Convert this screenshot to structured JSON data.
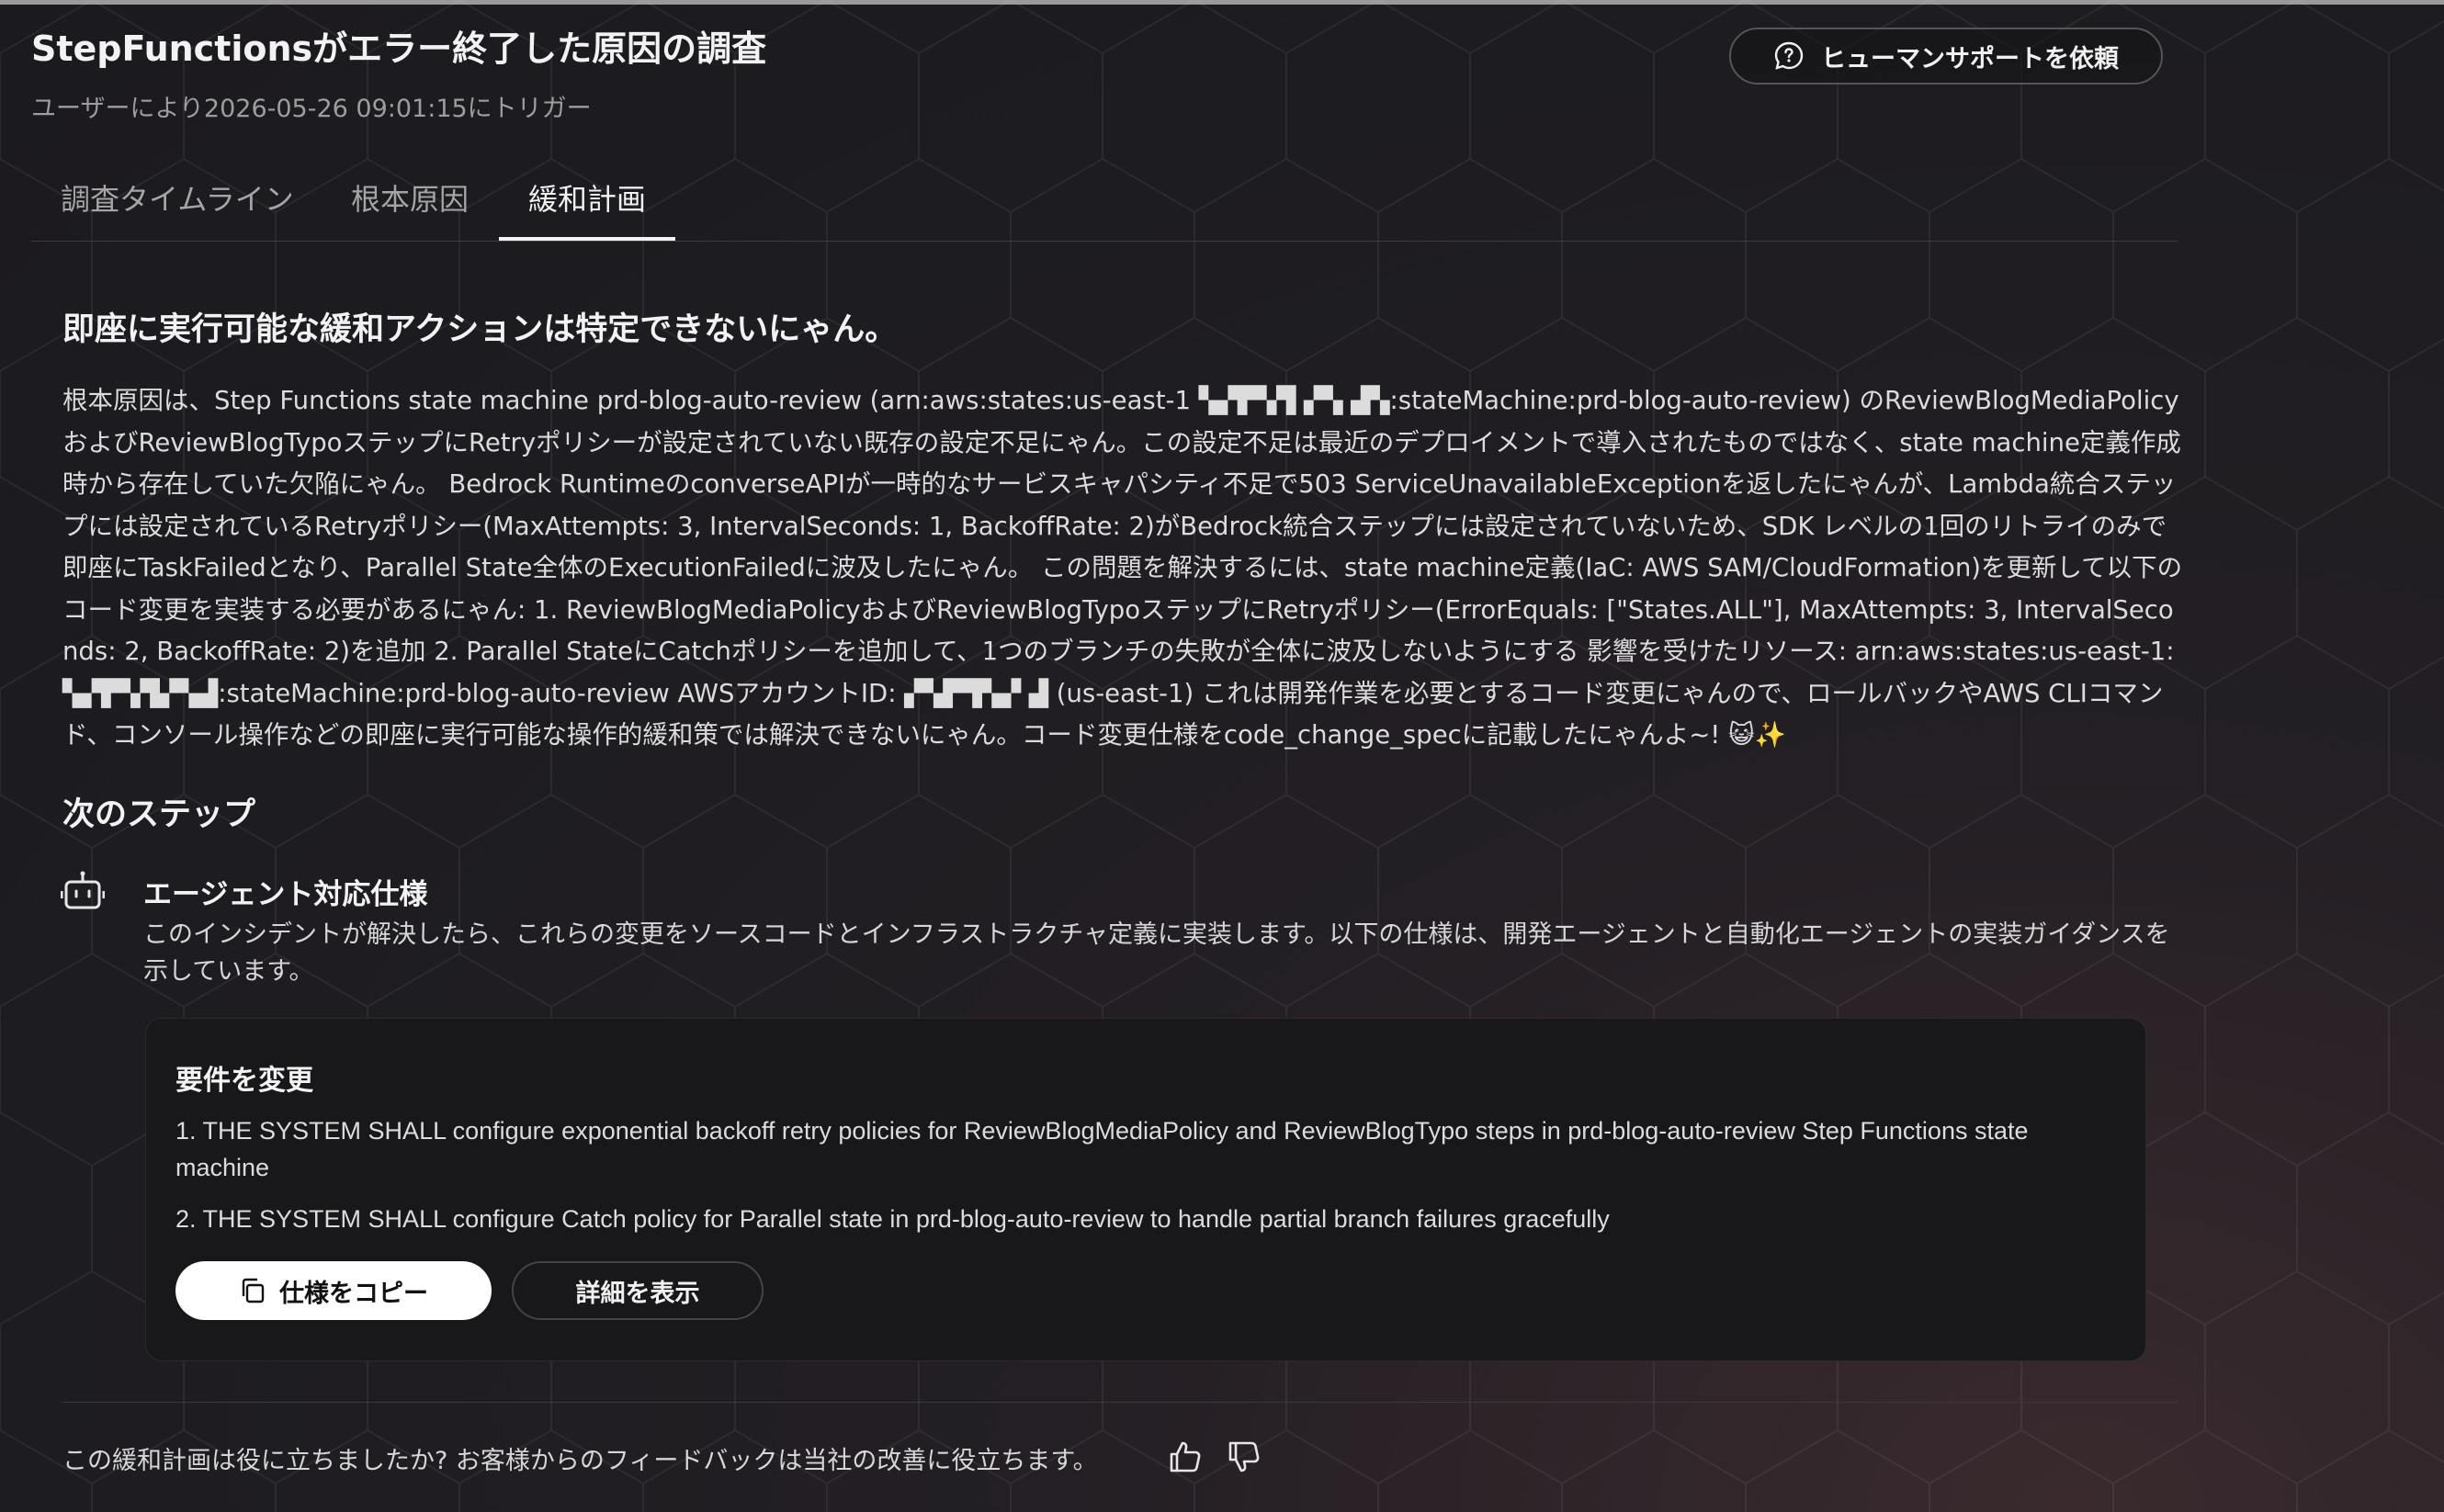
{
  "header": {
    "title": "StepFunctionsがエラー終了した原因の調査",
    "subtitle": "ユーザーにより2026-05-26 09:01:15にトリガー",
    "human_support_label": "ヒューマンサポートを依頼"
  },
  "tabs": [
    {
      "label": "調査タイムライン",
      "active": false
    },
    {
      "label": "根本原因",
      "active": false
    },
    {
      "label": "緩和計画",
      "active": true
    }
  ],
  "mitigation": {
    "headline": "即座に実行可能な緩和アクションは特定できないにゃん。",
    "body": "根本原因は、Step Functions state machine prd-blog-auto-review (arn:aws:states:us-east-1 ▚▞▛▚▜ ▞▚ ▟▚:stateMachine:prd-blog-auto-review) のReviewBlogMediaPolicyおよびReviewBlogTypoステップにRetryポリシーが設定されていない既存の設定不足にゃん。この設定不足は最近のデプロイメントで導入されたものではなく、state machine定義作成時から存在していた欠陥にゃん。 Bedrock RuntimeのconverseAPIが一時的なサービスキャパシティ不足で503 ServiceUnavailableExceptionを返したにゃんが、Lambda統合ステップには設定されているRetryポリシー(MaxAttempts: 3, IntervalSeconds: 1, BackoffRate: 2)がBedrock統合ステップには設定されていないため、SDK レベルの1回のリトライのみで即座にTaskFailedとなり、Parallel State全体のExecutionFailedに波及したにゃん。 この問題を解決するには、state machine定義(IaC: AWS SAM/CloudFormation)を更新して以下のコード変更を実装する必要があるにゃん: 1. ReviewBlogMediaPolicyおよびReviewBlogTypoステップにRetryポリシー(ErrorEquals: [\"States.ALL\"], MaxAttempts: 3, IntervalSeconds: 2, BackoffRate: 2)を追加 2. Parallel StateにCatchポリシーを追加して、1つのブランチの失敗が全体に波及しないようにする 影響を受けたリソース: arn:aws:states:us-east-1:▚▞▛▚▜▞▚▟:stateMachine:prd-blog-auto-review AWSアカウントID: ▞▚▛▜▚▞ ▟ (us-east-1) これは開発作業を必要とするコード変更にゃんので、ロールバックやAWS CLIコマンド、コンソール操作などの即座に実行可能な操作的緩和策では解決できないにゃん。コード変更仕様をcode_change_specに記載したにゃんよ~! 😺✨"
  },
  "next_steps": {
    "title": "次のステップ",
    "agent_title": "エージェント対応仕様",
    "agent_desc": "このインシデントが解決したら、これらの変更をソースコードとインフラストラクチャ定義に実装します。以下の仕様は、開発エージェントと自動化エージェントの実装ガイダンスを示しています。",
    "icon": "robot-icon"
  },
  "spec_card": {
    "title": "要件を変更",
    "items": [
      "1. THE SYSTEM SHALL configure exponential backoff retry policies for ReviewBlogMediaPolicy and ReviewBlogTypo steps in prd-blog-auto-review Step Functions state machine",
      "2. THE SYSTEM SHALL configure Catch policy for Parallel state in prd-blog-auto-review to handle partial branch failures gracefully"
    ],
    "copy_label": "仕様をコピー",
    "detail_label": "詳細を表示"
  },
  "feedback": {
    "text": "この緩和計画は役に立ちましたか? お客様からのフィードバックは当社の改善に役立ちます。"
  }
}
